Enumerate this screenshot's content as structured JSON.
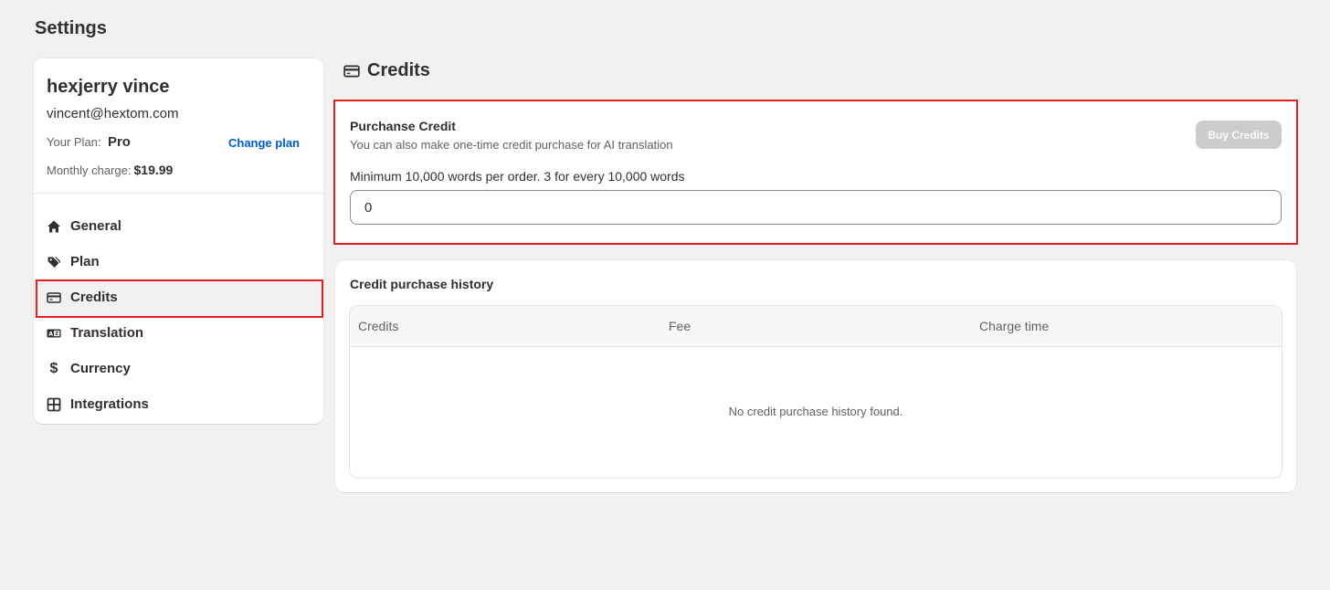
{
  "page": {
    "title": "Settings"
  },
  "account": {
    "name": "hexjerry vince",
    "email": "vincent@hextom.com",
    "plan_label": "Your Plan:",
    "plan_value": "Pro",
    "change_plan": "Change plan",
    "charge_label": "Monthly charge:",
    "charge_value": "$19.99"
  },
  "nav": {
    "items": [
      {
        "label": "General",
        "icon": "home-icon"
      },
      {
        "label": "Plan",
        "icon": "tag-icon"
      },
      {
        "label": "Credits",
        "icon": "credit-card-icon",
        "active": true
      },
      {
        "label": "Translation",
        "icon": "translate-icon"
      },
      {
        "label": "Currency",
        "icon": "dollar-icon"
      },
      {
        "label": "Integrations",
        "icon": "grid-icon"
      }
    ]
  },
  "main": {
    "title": "Credits",
    "purchase": {
      "heading": "Purchanse Credit",
      "subtitle": "You can also make one-time credit purchase for AI translation",
      "buy_button": "Buy Credits",
      "min_text": "Minimum 10,000 words per order. 3 for every 10,000 words",
      "input_value": "0"
    },
    "history": {
      "title": "Credit purchase history",
      "columns": [
        "Credits",
        "Fee",
        "Charge time"
      ],
      "empty_message": "No credit purchase history found."
    }
  },
  "colors": {
    "highlight": "#e22120",
    "link": "#005bd3",
    "disabled_button": "#cccccc"
  }
}
